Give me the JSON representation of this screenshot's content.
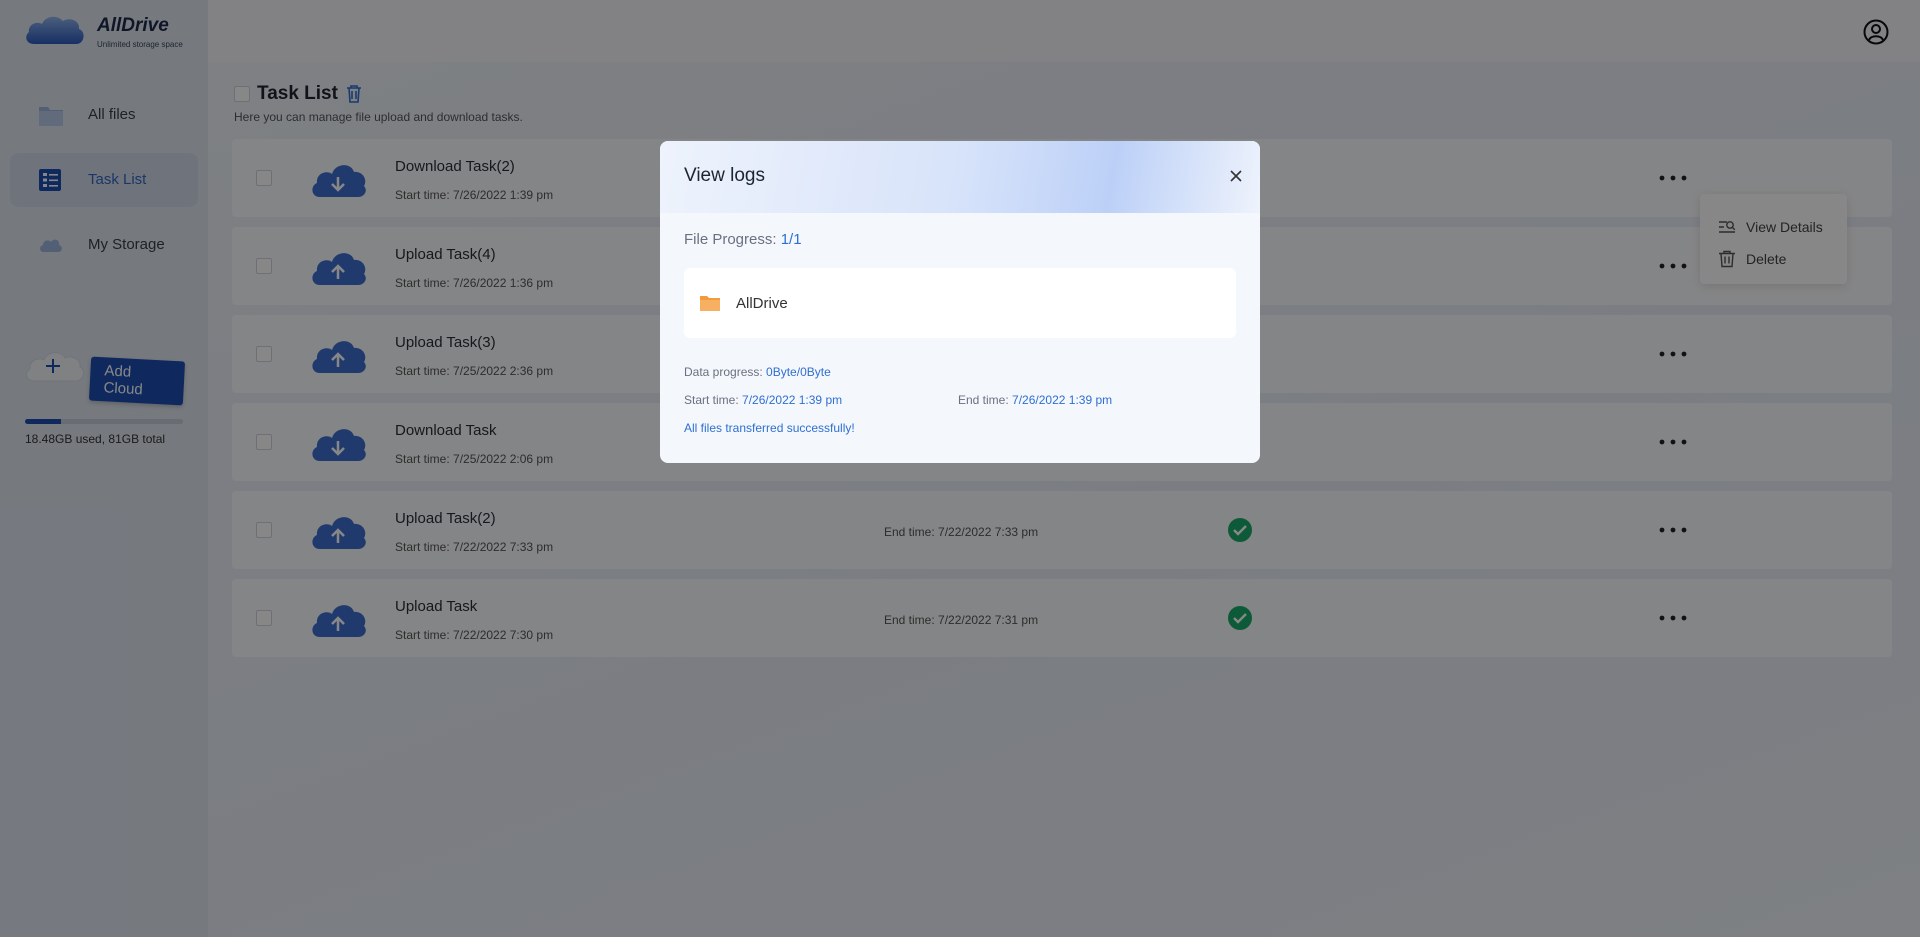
{
  "app": {
    "name": "AllDrive",
    "tagline": "Unlimited storage space"
  },
  "sidebar": {
    "items": [
      {
        "label": "All files",
        "icon": "folder-icon"
      },
      {
        "label": "Task List",
        "icon": "task-list-icon",
        "active": true
      },
      {
        "label": "My Storage",
        "icon": "cloud-icon"
      }
    ],
    "add_cloud_label": "Add Cloud",
    "storage": {
      "text": "18.48GB used, 81GB total",
      "used_fraction": 0.228
    }
  },
  "page": {
    "title": "Task List",
    "subtitle": "Here you can manage file upload and download tasks."
  },
  "tasks": [
    {
      "name": "Download Task(2)",
      "start": "Start time: 7/26/2022 1:39 pm",
      "end": "",
      "direction": "download"
    },
    {
      "name": "Upload Task(4)",
      "start": "Start time: 7/26/2022 1:36 pm",
      "end": "",
      "direction": "upload"
    },
    {
      "name": "Upload Task(3)",
      "start": "Start time: 7/25/2022 2:36 pm",
      "end": "",
      "direction": "upload"
    },
    {
      "name": "Download Task",
      "start": "Start time: 7/25/2022 2:06 pm",
      "end": "",
      "direction": "download"
    },
    {
      "name": "Upload Task(2)",
      "start": "Start time: 7/22/2022 7:33 pm",
      "end": "End time: 7/22/2022 7:33 pm",
      "direction": "upload"
    },
    {
      "name": "Upload Task",
      "start": "Start time: 7/22/2022 7:30 pm",
      "end": "End time: 7/22/2022 7:31 pm",
      "direction": "upload"
    }
  ],
  "context_menu": {
    "view_details": "View Details",
    "delete": "Delete"
  },
  "modal": {
    "title": "View logs",
    "file_progress_label": "File Progress:",
    "file_progress_value": "1/1",
    "file_name": "AllDrive",
    "data_progress_label": "Data progress:",
    "data_progress_value": "0Byte/0Byte",
    "start_label": "Start time:",
    "start_value": "7/26/2022 1:39 pm",
    "end_label": "End time:",
    "end_value": "7/26/2022 1:39 pm",
    "message": "All files transferred successfully!"
  },
  "colors": {
    "accent": "#2f6fd1",
    "brand": "#1d4fb3",
    "success": "#1aaa6a",
    "folder": "#f7a24b"
  }
}
